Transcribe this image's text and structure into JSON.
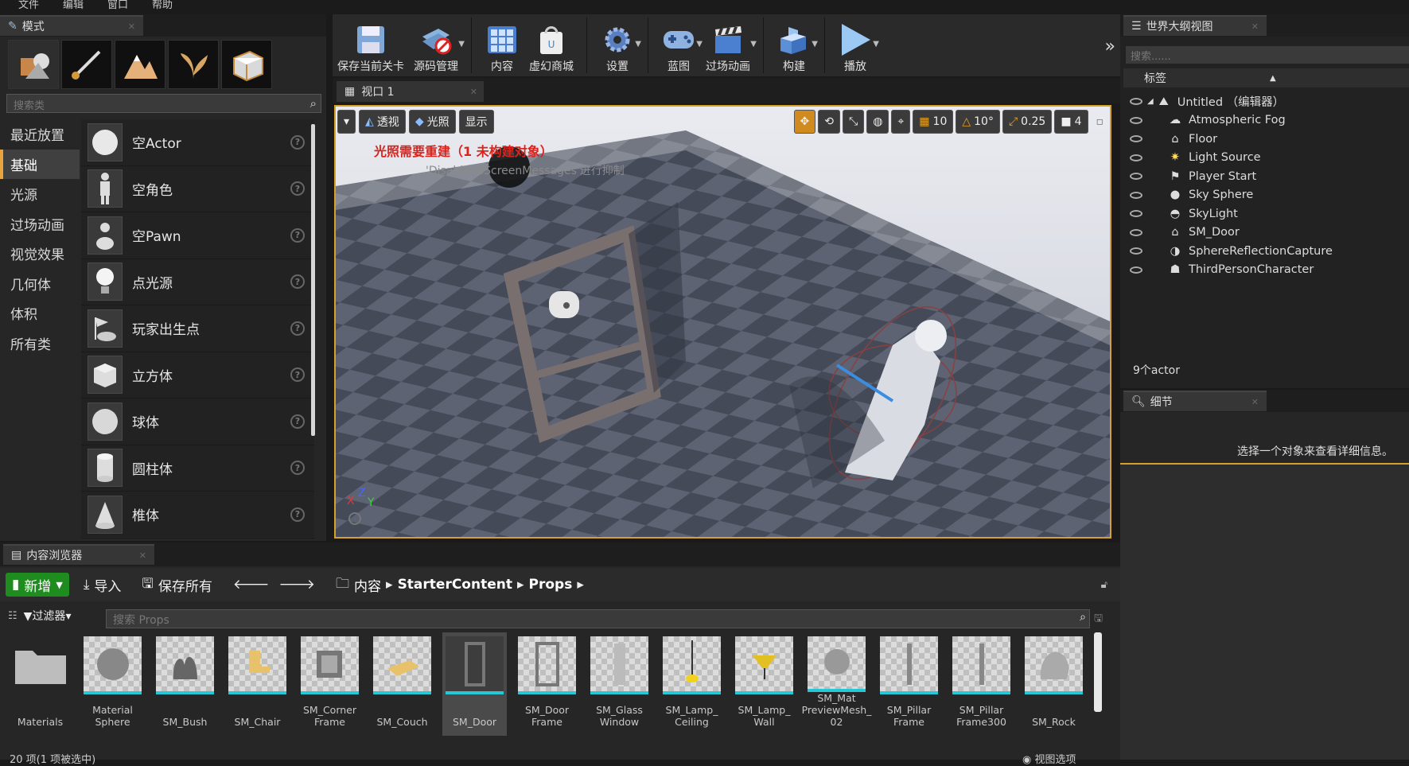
{
  "menu": [
    "文件",
    "编辑",
    "窗口",
    "帮助"
  ],
  "modes": {
    "tab": "模式",
    "search_placeholder": "搜索类",
    "categories": [
      "最近放置",
      "基础",
      "光源",
      "过场动画",
      "视觉效果",
      "几何体",
      "体积",
      "所有类"
    ],
    "items": [
      "空Actor",
      "空角色",
      "空Pawn",
      "点光源",
      "玩家出生点",
      "立方体",
      "球体",
      "圆柱体",
      "椎体"
    ]
  },
  "toolbar": {
    "save": "保存当前关卡",
    "source": "源码管理",
    "content": "内容",
    "market": "虚幻商城",
    "settings": "设置",
    "blueprint": "蓝图",
    "cinematics": "过场动画",
    "build": "构建",
    "play": "播放"
  },
  "viewport": {
    "tab": "视口 1",
    "perspective": "透视",
    "lit": "光照",
    "show": "显示",
    "grid": "10",
    "rot": "10°",
    "scale": "0.25",
    "cam": "4",
    "warning": "光照需要重建（1 未构建对象）",
    "warning_sub": "'DisableAllScreenMessages'进行抑制"
  },
  "outliner": {
    "tab": "世界大纲视图",
    "search_placeholder": "搜索......",
    "col": "标签",
    "root": "Untitled （编辑器）",
    "rows": [
      "Atmospheric Fog",
      "Floor",
      "Light Source",
      "Player Start",
      "Sky Sphere",
      "SkyLight",
      "SM_Door",
      "SphereReflectionCapture",
      "ThirdPersonCharacter"
    ],
    "count": "9个actor"
  },
  "details": {
    "tab": "细节",
    "msg": "选择一个对象来查看详细信息。"
  },
  "cb": {
    "tab": "内容浏览器",
    "new": "新增",
    "import": "导入",
    "save_all": "保存所有",
    "path": [
      "内容",
      "StarterContent",
      "Props"
    ],
    "filter": "过滤器",
    "search_placeholder": "搜索 Props",
    "assets": [
      "Materials",
      "Material Sphere",
      "SM_Bush",
      "SM_Chair",
      "SM_Corner Frame",
      "SM_Couch",
      "SM_Door",
      "SM_Door Frame",
      "SM_Glass Window",
      "SM_Lamp_ Ceiling",
      "SM_Lamp_ Wall",
      "SM_Mat PreviewMesh_ 02",
      "SM_Pillar Frame",
      "SM_Pillar Frame300",
      "SM_Rock"
    ],
    "status": "20 项(1 项被选中)",
    "view_options": "视图选项"
  }
}
